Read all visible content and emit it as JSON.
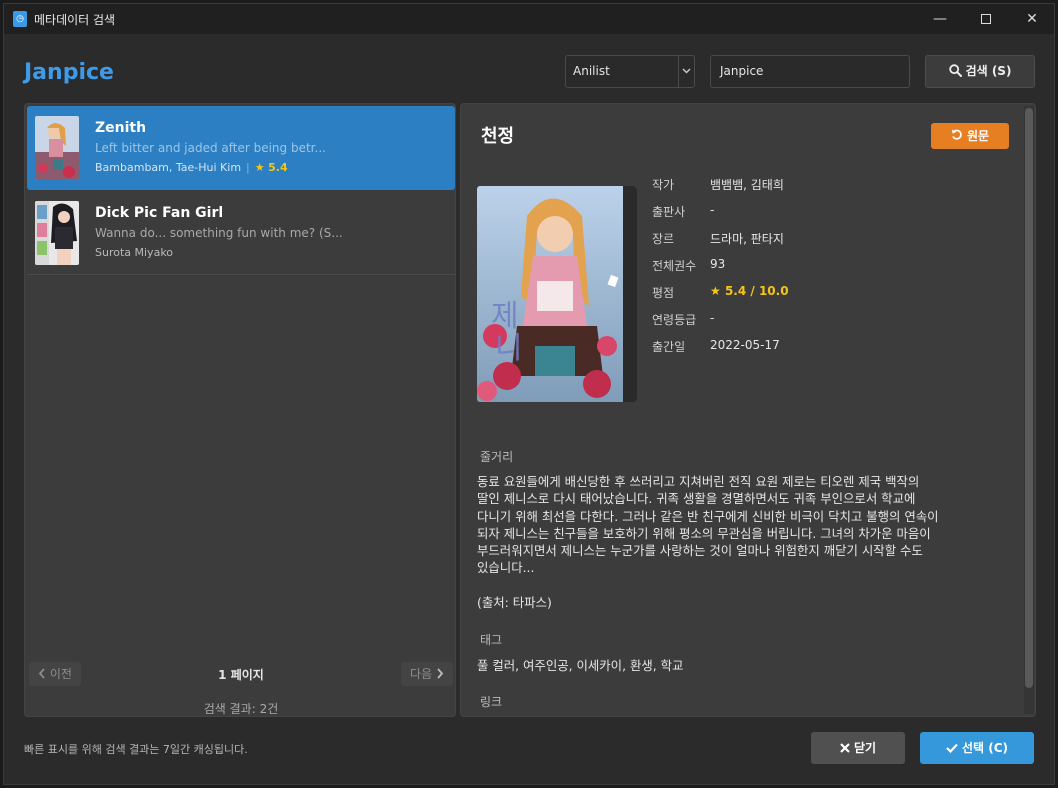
{
  "window": {
    "title": "메타데이터 검색",
    "minimize_glyph": "—",
    "close_glyph": "✕",
    "icon": "app-icon"
  },
  "header": {
    "brand": "Janpice",
    "source_select": {
      "selected": "Anilist"
    },
    "search_input": {
      "value": "Janpice"
    },
    "search_button": "검색 (S)"
  },
  "results": {
    "items": [
      {
        "title": "Zenith",
        "description": "Left bitter and jaded after being betr...",
        "authors": "Bambambam, Tae-Hui Kim",
        "separator": "|",
        "rating": "5.4",
        "selected": true
      },
      {
        "title": "Dick Pic Fan Girl",
        "description": "Wanna do... something fun with me?  (S...",
        "authors": "Surota Miyako",
        "selected": false
      }
    ],
    "pager": {
      "prev_label": "이전",
      "next_label": "다음",
      "page_label": "1 페이지"
    },
    "result_count": "검색 결과: 2건"
  },
  "detail": {
    "title": "천정",
    "origin_button": "원문",
    "meta": [
      {
        "key": "작가",
        "value": "뱀뱀뱀, 김태희"
      },
      {
        "key": "출판사",
        "value": "-"
      },
      {
        "key": "장르",
        "value": "드라마, 판타지"
      },
      {
        "key": "전체권수",
        "value": "93"
      },
      {
        "key": "평점",
        "value": "5.4 / 10.0"
      },
      {
        "key": "연령등급",
        "value": "-"
      },
      {
        "key": "출간일",
        "value": "2022-05-17"
      }
    ],
    "synopsis_label": "줄거리",
    "synopsis_lines": [
      "동료 요원들에게 배신당한 후 쓰러리고 지쳐버린 전직 요원 제로는 티오렌 제국 백작의",
      "딸인 제니스로 다시 태어났습니다. 귀족 생활을 경멸하면서도 귀족 부인으로서 학교에",
      "다니기 위해 최선을 다한다. 그러나 같은 반 친구에게 신비한 비극이 닥치고 불행의 연속이",
      "되자 제니스는 친구들을 보호하기 위해 평소의 무관심을 버립니다. 그녀의 차가운 마음이",
      "부드러워지면서 제니스는 누군가를 사랑하는 것이 얼마나 위험한지 깨닫기 시작할 수도",
      "있습니다..."
    ],
    "source_note": "(출처: 타파스)",
    "tags_label": "태그",
    "tags": "풀 컬러, 여주인공, 이세카이, 환생, 학교",
    "links_label": "링크"
  },
  "footer": {
    "note": "빠른 표시를 위해 검색 결과는 7일간 캐싱됩니다.",
    "close_button": "닫기",
    "select_button": "선택 (C)"
  },
  "colors": {
    "accent": "#3d9be9",
    "selection": "#2b7fc2",
    "origin_button": "#e67e22",
    "select_button": "#3498db",
    "rating": "#f5c518"
  }
}
